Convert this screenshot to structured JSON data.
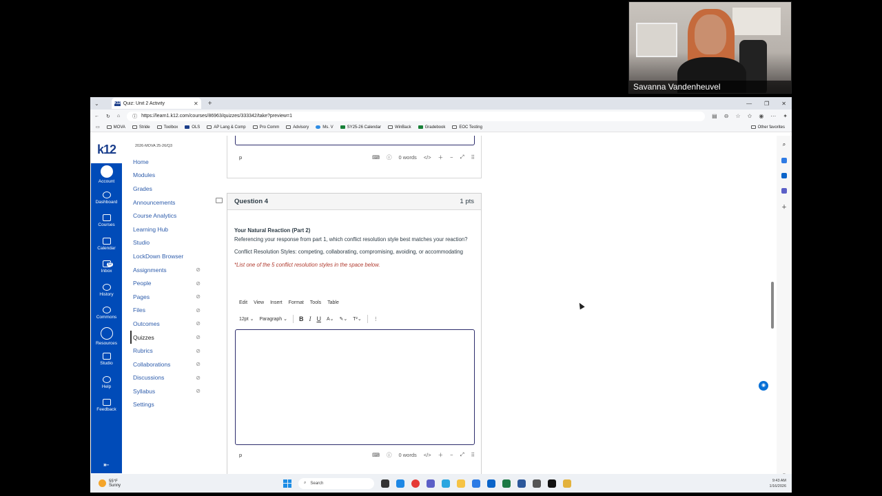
{
  "webcam": {
    "name": "Savanna Vandenheuvel"
  },
  "browser": {
    "tab_title": "Quiz: Unit 2 Activity",
    "tab_favicon": "K12",
    "new_tab": "+",
    "url": "https://learn1.k12.com/courses/86963/quizzes/333342/take?preview=1",
    "bookmarks": [
      "MOVA",
      "Stride",
      "Toolbox",
      "OLS",
      "AP Lang & Comp",
      "Pro Comm",
      "Advisory",
      "Ms. V",
      "SY25-26 Calendar",
      "WinBack",
      "Gradebook",
      "EOC Testing"
    ],
    "other_favorites": "Other favorites"
  },
  "global_nav": {
    "logo": "k12",
    "items": [
      {
        "label": "Account"
      },
      {
        "label": "Dashboard"
      },
      {
        "label": "Courses"
      },
      {
        "label": "Calendar"
      },
      {
        "label": "Inbox",
        "badge": "52"
      },
      {
        "label": "History"
      },
      {
        "label": "Commons"
      },
      {
        "label": "Resources"
      },
      {
        "label": "Studio"
      },
      {
        "label": "Help"
      },
      {
        "label": "Feedback"
      }
    ]
  },
  "course_nav": {
    "term": "2026-MOVA 25-26/Q3",
    "items": [
      {
        "label": "Home",
        "hidden": false
      },
      {
        "label": "Modules",
        "hidden": false
      },
      {
        "label": "Grades",
        "hidden": false
      },
      {
        "label": "Announcements",
        "hidden": false
      },
      {
        "label": "Course Analytics",
        "hidden": false
      },
      {
        "label": "Learning Hub",
        "hidden": false
      },
      {
        "label": "Studio",
        "hidden": false
      },
      {
        "label": "LockDown Browser",
        "hidden": false
      },
      {
        "label": "Assignments",
        "hidden": true
      },
      {
        "label": "People",
        "hidden": true
      },
      {
        "label": "Pages",
        "hidden": true
      },
      {
        "label": "Files",
        "hidden": true
      },
      {
        "label": "Outcomes",
        "hidden": true
      },
      {
        "label": "Quizzes",
        "hidden": true,
        "active": true
      },
      {
        "label": "Rubrics",
        "hidden": true
      },
      {
        "label": "Collaborations",
        "hidden": true
      },
      {
        "label": "Discussions",
        "hidden": true
      },
      {
        "label": "Syllabus",
        "hidden": true
      },
      {
        "label": "Settings",
        "hidden": false
      }
    ]
  },
  "prev_editor": {
    "path": "p",
    "word_count": "0 words"
  },
  "question": {
    "number": "Question 4",
    "points": "1 pts",
    "title": "Your Natural Reaction (Part 2)",
    "prompt": "Referencing your response from part 1, which conflict resolution style best matches your reaction?",
    "styles": "Conflict Resolution Styles: competing, collaborating, compromising, avoiding, or accommodating",
    "note": "*List one of the 5 conflict resolution styles in the space below.",
    "menu": [
      "Edit",
      "View",
      "Insert",
      "Format",
      "Tools",
      "Table"
    ],
    "font_size": "12pt",
    "block_format": "Paragraph",
    "editor_value": "",
    "path": "p",
    "word_count": "0 words"
  },
  "taskbar": {
    "temperature": "55°F",
    "condition": "Sunny",
    "search_placeholder": "Search",
    "time": "9:43 AM",
    "date": "1/16/2026"
  }
}
